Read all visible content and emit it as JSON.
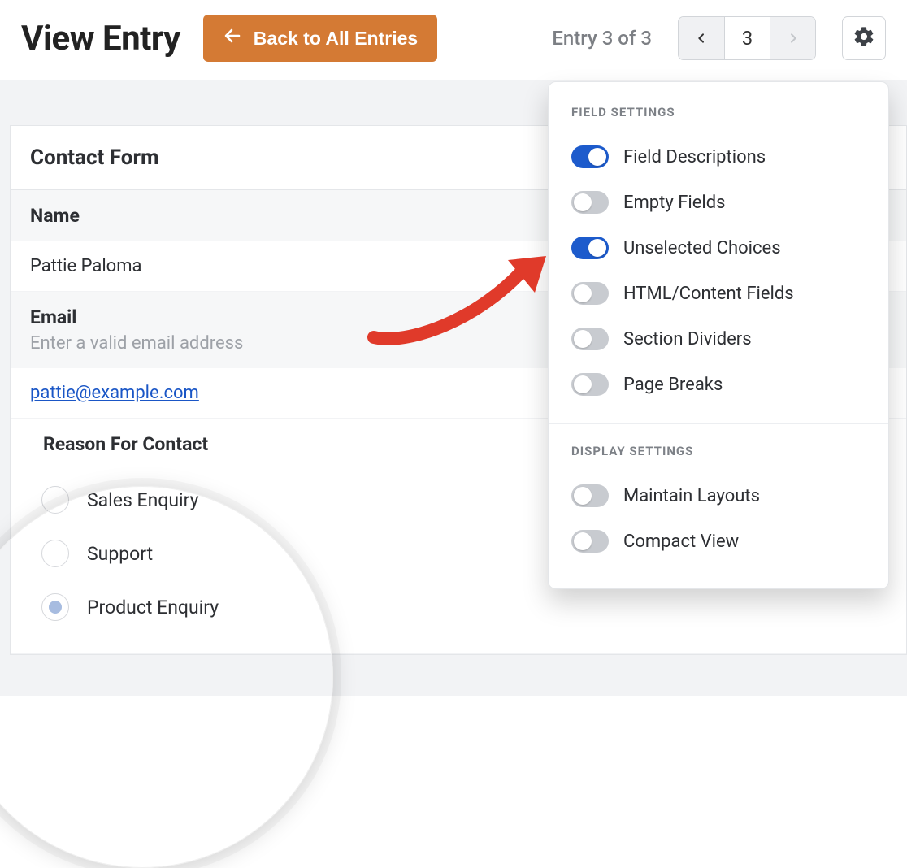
{
  "header": {
    "title": "View Entry",
    "back_label": "Back to All Entries",
    "entry_count_text": "Entry 3 of 3",
    "current_entry": "3"
  },
  "form": {
    "card_title": "Contact Form",
    "name_label": "Name",
    "name_value": "Pattie Paloma",
    "email_label": "Email",
    "email_hint": "Enter a valid email address",
    "email_value": "pattie@example.com",
    "reason_label": "Reason For Contact",
    "choices": [
      {
        "label": "Sales Enquiry",
        "selected": false
      },
      {
        "label": "Support",
        "selected": false
      },
      {
        "label": "Product Enquiry",
        "selected": true
      }
    ]
  },
  "dropdown": {
    "field_section": "FIELD SETTINGS",
    "display_section": "DISPLAY SETTINGS",
    "items_field": [
      {
        "label": "Field Descriptions",
        "on": true
      },
      {
        "label": "Empty Fields",
        "on": false
      },
      {
        "label": "Unselected Choices",
        "on": true
      },
      {
        "label": "HTML/Content Fields",
        "on": false
      },
      {
        "label": "Section Dividers",
        "on": false
      },
      {
        "label": "Page Breaks",
        "on": false
      }
    ],
    "items_display": [
      {
        "label": "Maintain Layouts",
        "on": false
      },
      {
        "label": "Compact View",
        "on": false
      }
    ]
  }
}
